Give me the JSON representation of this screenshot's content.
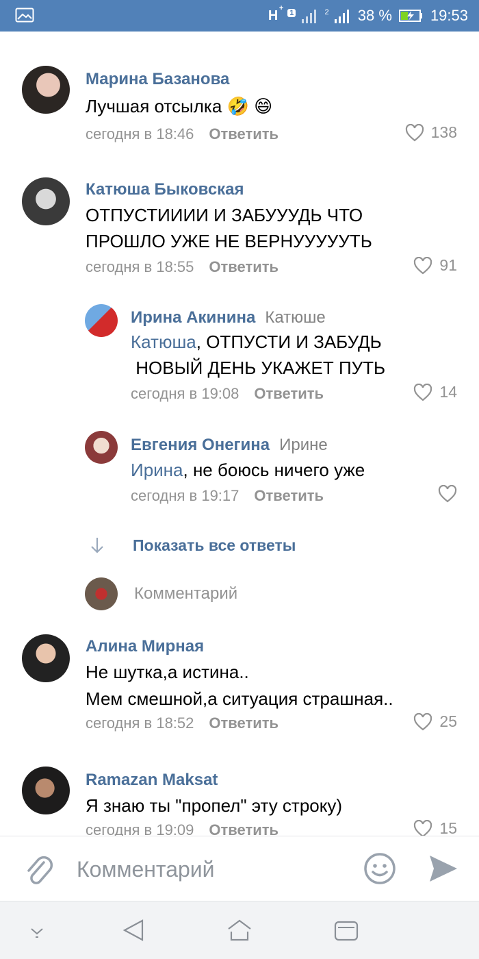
{
  "status_bar": {
    "network": "H",
    "network_plus": "+",
    "sim1_badge": "1",
    "sim2_badge": "2",
    "battery": "38 %",
    "time": "19:53"
  },
  "comments": [
    {
      "author": "Марина Базанова",
      "text": "Лучшая отсылка 🤣 😄",
      "time": "сегодня в 18:46",
      "reply": "Ответить",
      "likes": "138"
    },
    {
      "author": "Катюша Быковская",
      "text_line1": "ОТПУСТИИИИ И ЗАБУУУДЬ ЧТО",
      "text_line2": "ПРОШЛО УЖЕ НЕ ВЕРНУУУУУТЬ",
      "time": "сегодня в 18:55",
      "reply": "Ответить",
      "likes": "91"
    },
    {
      "author": "Ирина Акинина",
      "addressee": "Катюше",
      "mention": "Катюша",
      "text_line1_rest": ", ОТПУСТИ И ЗАБУДЬ",
      "text_line2": " НОВЫЙ ДЕНЬ УКАЖЕТ ПУТЬ",
      "time": "сегодня в 19:08",
      "reply": "Ответить",
      "likes": "14"
    },
    {
      "author": "Евгения Онегина",
      "addressee": "Ирине",
      "mention": "Ирина",
      "text_rest": ", не боюсь ничего уже",
      "time": "сегодня в 19:17",
      "reply": "Ответить"
    },
    {
      "author": "Алина Мирная",
      "text_line1": "Не шутка,а истина..",
      "text_line2": "Мем смешной,а ситуация страшная..",
      "time": "сегодня в 18:52",
      "reply": "Ответить",
      "likes": "25"
    },
    {
      "author": "Ramazan Maksat",
      "text": "Я знаю ты \"пропел\" эту строку)",
      "time": "сегодня в 19:09",
      "reply": "Ответить",
      "likes": "15"
    }
  ],
  "show_all_replies": "Показать все ответы",
  "reply_input_placeholder": "Комментарий",
  "input_bar": {
    "placeholder": "Комментарий"
  },
  "colors": {
    "status_bar": "#5181b8",
    "link": "#4a6f99",
    "meta": "#939393"
  },
  "icons": [
    "gallery-icon",
    "heart-icon",
    "arrow-down-icon",
    "paperclip-icon",
    "emoji-icon",
    "send-icon",
    "nav-down-icon",
    "nav-back-icon",
    "nav-home-icon",
    "nav-recents-icon"
  ]
}
